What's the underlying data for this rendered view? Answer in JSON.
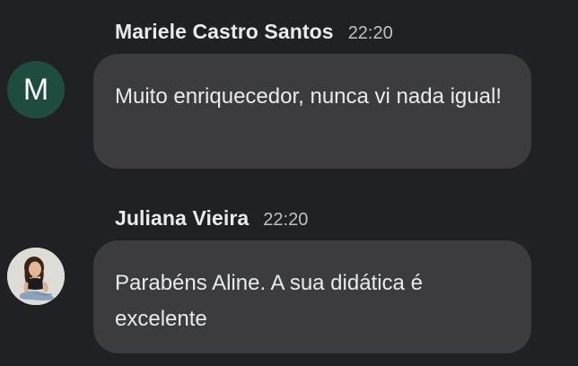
{
  "messages": [
    {
      "sender": "Mariele Castro Santos",
      "time": "22:20",
      "avatar": {
        "type": "letter",
        "letter": "M",
        "color": "#1e4d3f"
      },
      "text": "Muito enriquecedor, nunca vi nada igual!"
    },
    {
      "sender": "Juliana Vieira",
      "time": "22:20",
      "avatar": {
        "type": "photo",
        "icon": "user-photo-avatar"
      },
      "text": "Parabéns Aline. A sua didática é excelente"
    }
  ],
  "colors": {
    "background": "#202124",
    "bubble": "#3c3c3f",
    "text": "#e8eaed",
    "timestamp": "#bdc1c6"
  }
}
